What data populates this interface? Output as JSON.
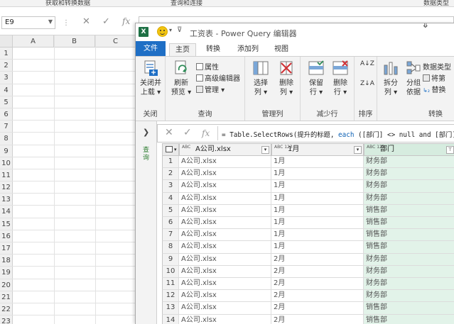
{
  "excel": {
    "ribbon_groups": [
      "获取和转换数据",
      "查询和连接",
      "数据类型"
    ],
    "name_box": "E9",
    "formula_buttons": [
      "✕",
      "✓",
      "fx"
    ],
    "columns": [
      "A",
      "B",
      "C"
    ],
    "rows": [
      "1",
      "2",
      "3",
      "4",
      "5",
      "6",
      "7",
      "8",
      "9",
      "10",
      "11",
      "12",
      "13",
      "14",
      "15",
      "16",
      "17",
      "18",
      "19",
      "20",
      "21",
      "22",
      "23"
    ]
  },
  "pq": {
    "title": "工资表 - Power Query 编辑器",
    "logo": "X",
    "tabs": [
      "文件",
      "主页",
      "转换",
      "添加列",
      "视图"
    ],
    "active_tab": "主页",
    "ribbon": {
      "close_load": [
        "关闭并",
        "上载"
      ],
      "refresh": [
        "刷新",
        "预览"
      ],
      "properties": "属性",
      "advanced_editor": "高级编辑器",
      "manage": "管理",
      "choose_columns": [
        "选择",
        "列"
      ],
      "remove_columns": [
        "删除",
        "列"
      ],
      "keep_rows": [
        "保留",
        "行"
      ],
      "remove_rows": [
        "删除",
        "行"
      ],
      "split_column": [
        "拆分",
        "列"
      ],
      "group_by": [
        "分组",
        "依据"
      ],
      "data_type": "数据类型",
      "use_first_row": "将第",
      "replace_values": "替换",
      "sort_az": "A↓Z",
      "sort_za": "Z↓A",
      "groups": {
        "close": "关闭",
        "query": "查询",
        "manage_columns": "管理列",
        "reduce_rows": "减少行",
        "sort": "排序",
        "transform": "转换"
      }
    },
    "nav_label": "查询",
    "formula": {
      "prefix": "= Table.SelectRows(提升的标题, ",
      "kw": "each",
      "suffix": " ([部门] <> null and [部门]"
    },
    "table": {
      "columns": [
        {
          "type": "ABC",
          "name": "A公司.xlsx"
        },
        {
          "type": "ABC 123",
          "name": "1月"
        },
        {
          "type": "ABC 123",
          "name": "部门"
        }
      ],
      "rows": [
        [
          "1",
          "A公司.xlsx",
          "1月",
          "财务部"
        ],
        [
          "2",
          "A公司.xlsx",
          "1月",
          "财务部"
        ],
        [
          "3",
          "A公司.xlsx",
          "1月",
          "财务部"
        ],
        [
          "4",
          "A公司.xlsx",
          "1月",
          "财务部"
        ],
        [
          "5",
          "A公司.xlsx",
          "1月",
          "销售部"
        ],
        [
          "6",
          "A公司.xlsx",
          "1月",
          "销售部"
        ],
        [
          "7",
          "A公司.xlsx",
          "1月",
          "销售部"
        ],
        [
          "8",
          "A公司.xlsx",
          "1月",
          "销售部"
        ],
        [
          "9",
          "A公司.xlsx",
          "2月",
          "财务部"
        ],
        [
          "10",
          "A公司.xlsx",
          "2月",
          "财务部"
        ],
        [
          "11",
          "A公司.xlsx",
          "2月",
          "财务部"
        ],
        [
          "12",
          "A公司.xlsx",
          "2月",
          "财务部"
        ],
        [
          "13",
          "A公司.xlsx",
          "2月",
          "销售部"
        ],
        [
          "14",
          "A公司.xlsx",
          "2月",
          "销售部"
        ]
      ]
    }
  }
}
